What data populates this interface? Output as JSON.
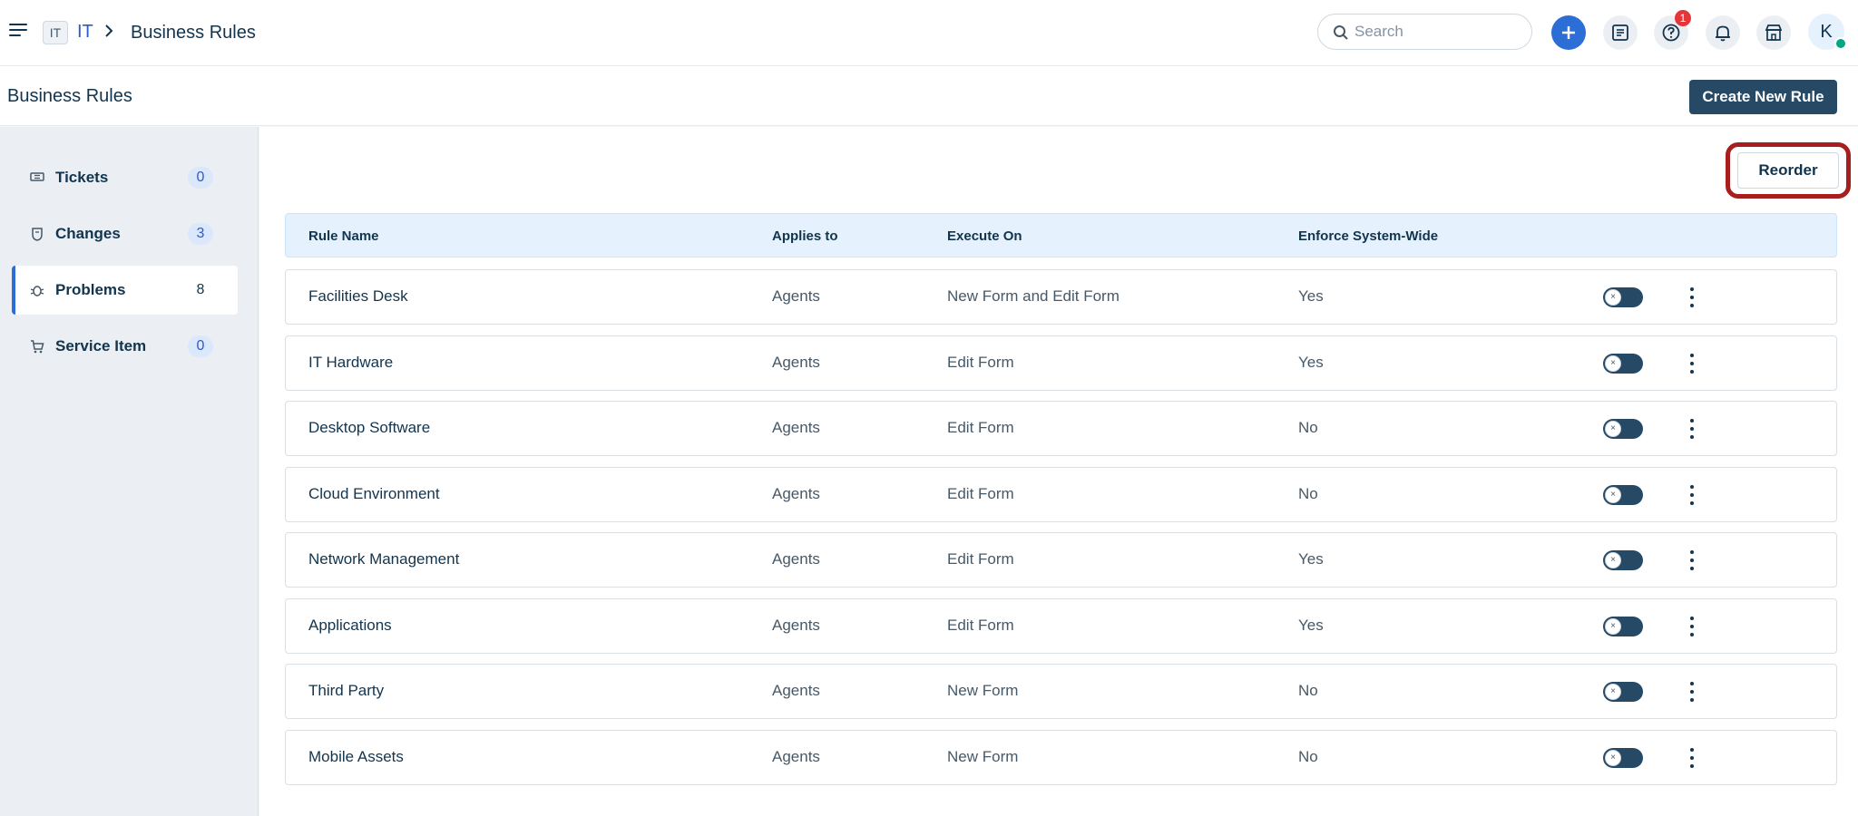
{
  "topbar": {
    "workspace_badge": "IT",
    "workspace_name": "IT",
    "breadcrumb_separator": "›",
    "breadcrumb_title": "Business Rules",
    "search_placeholder": "Search",
    "notification_count": "1",
    "avatar_initial": "K"
  },
  "subheader": {
    "title": "Business Rules",
    "create_button": "Create New Rule"
  },
  "sidebar": {
    "items": [
      {
        "label": "Tickets",
        "count": "0",
        "icon": "ticket-icon"
      },
      {
        "label": "Changes",
        "count": "3",
        "icon": "change-icon"
      },
      {
        "label": "Problems",
        "count": "8",
        "icon": "problem-icon",
        "active": true
      },
      {
        "label": "Service Item",
        "count": "0",
        "icon": "service-item-icon"
      }
    ]
  },
  "main": {
    "reorder_button": "Reorder",
    "columns": [
      "Rule Name",
      "Applies to",
      "Execute On",
      "Enforce System-Wide"
    ],
    "toggle_glyph": "×",
    "rows": [
      {
        "name": "Facilities Desk",
        "applies": "Agents",
        "execute": "New Form and Edit Form",
        "enforce": "Yes"
      },
      {
        "name": "IT Hardware",
        "applies": "Agents",
        "execute": "Edit Form",
        "enforce": "Yes"
      },
      {
        "name": "Desktop Software",
        "applies": "Agents",
        "execute": "Edit Form",
        "enforce": "No"
      },
      {
        "name": "Cloud Environment",
        "applies": "Agents",
        "execute": "Edit Form",
        "enforce": "No"
      },
      {
        "name": "Network Management",
        "applies": "Agents",
        "execute": "Edit Form",
        "enforce": "Yes"
      },
      {
        "name": "Applications",
        "applies": "Agents",
        "execute": "Edit Form",
        "enforce": "Yes"
      },
      {
        "name": "Third Party",
        "applies": "Agents",
        "execute": "New Form",
        "enforce": "No"
      },
      {
        "name": "Mobile Assets",
        "applies": "Agents",
        "execute": "New Form",
        "enforce": "No"
      }
    ]
  },
  "colors": {
    "accent": "#2c6ed5",
    "primary_button": "#264966",
    "highlight_outline": "#a61e1e",
    "notification": "#e43538",
    "online": "#00a886"
  }
}
